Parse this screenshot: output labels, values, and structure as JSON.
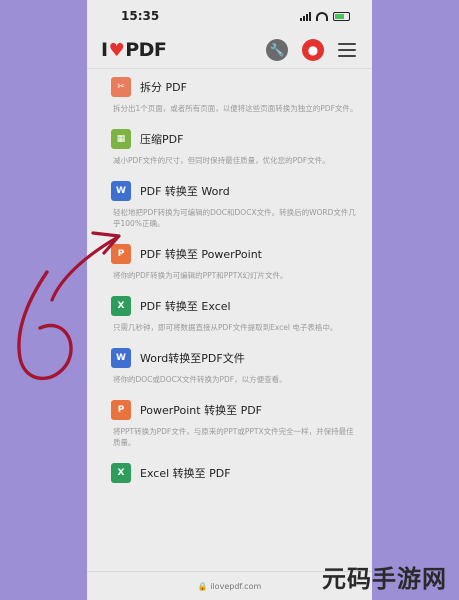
{
  "status": {
    "time": "15:35"
  },
  "header": {
    "logo_left": "I",
    "logo_right": "PDF"
  },
  "tools": [
    {
      "icon": "split-icon",
      "color": "#e87c5c",
      "glyph": "✂",
      "name": "拆分 PDF",
      "desc": "拆分出1个页面，或者所有页面，以便将这些页面转换为独立的PDF文件。"
    },
    {
      "icon": "compress-icon",
      "color": "#7cb342",
      "glyph": "▦",
      "name": "压缩PDF",
      "desc": "减小PDF文件的尺寸，但同时保持最佳质量，优化您的PDF文件。"
    },
    {
      "icon": "word-icon",
      "color": "#3f6fd1",
      "glyph": "W",
      "name": "PDF 转换至 Word",
      "desc": "轻松地把PDF转换为可编辑的DOC和DOCX文件。转换后的WORD文件几乎100%正确。"
    },
    {
      "icon": "powerpoint-icon",
      "color": "#e8733f",
      "glyph": "P",
      "name": "PDF 转换至 PowerPoint",
      "desc": "将你的PDF转换为可编辑的PPT和PPTX幻灯片文件。"
    },
    {
      "icon": "excel-icon",
      "color": "#2e9d5b",
      "glyph": "X",
      "name": "PDF 转换至 Excel",
      "desc": "只需几秒钟，即可将数据直接从PDF文件提取到Excel 电子表格中。"
    },
    {
      "icon": "word-to-pdf-icon",
      "color": "#3f6fd1",
      "glyph": "W",
      "name": "Word转换至PDF文件",
      "desc": "将你的DOC或DOCX文件转换为PDF，以方便查看。"
    },
    {
      "icon": "powerpoint-to-pdf-icon",
      "color": "#e8733f",
      "glyph": "P",
      "name": "PowerPoint 转换至 PDF",
      "desc": "将PPT转换为PDF文件，与原来的PPT或PPTX文件完全一样，并保持最佳质量。"
    },
    {
      "icon": "excel-to-pdf-icon",
      "color": "#2e9d5b",
      "glyph": "X",
      "name": "Excel 转换至 PDF",
      "desc": ""
    }
  ],
  "bottom": {
    "url": "🔒 ilovepdf.com"
  },
  "annotation": {
    "number": "6"
  },
  "watermark": {
    "text": "元码手游网"
  }
}
